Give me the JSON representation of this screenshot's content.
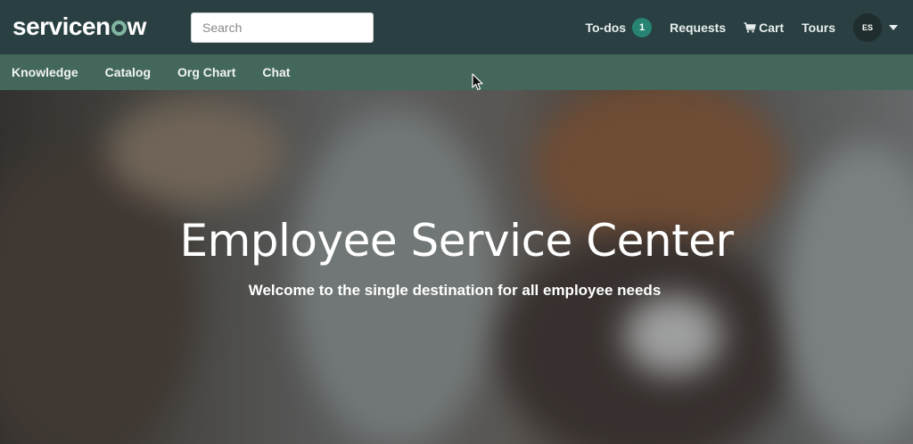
{
  "header": {
    "logo_text_pre": "servicen",
    "logo_text_post": "w",
    "search": {
      "placeholder": "Search",
      "value": ""
    },
    "nav": {
      "todos_label": "To-dos",
      "todos_count": "1",
      "requests_label": "Requests",
      "cart_label": "Cart",
      "tours_label": "Tours",
      "avatar_initials": "ES"
    }
  },
  "subnav": {
    "items": [
      {
        "label": "Knowledge"
      },
      {
        "label": "Catalog"
      },
      {
        "label": "Org Chart"
      },
      {
        "label": "Chat"
      }
    ]
  },
  "hero": {
    "title": "Employee Service Center",
    "subtitle": "Welcome to the single destination for all employee needs"
  },
  "colors": {
    "topbar": "#293f41",
    "subnav": "#44675b",
    "badge": "#278473",
    "logo_accent": "#81b5a1"
  },
  "icons": {
    "search": "search-icon",
    "cart": "cart-icon",
    "caret": "chevron-down-icon"
  }
}
